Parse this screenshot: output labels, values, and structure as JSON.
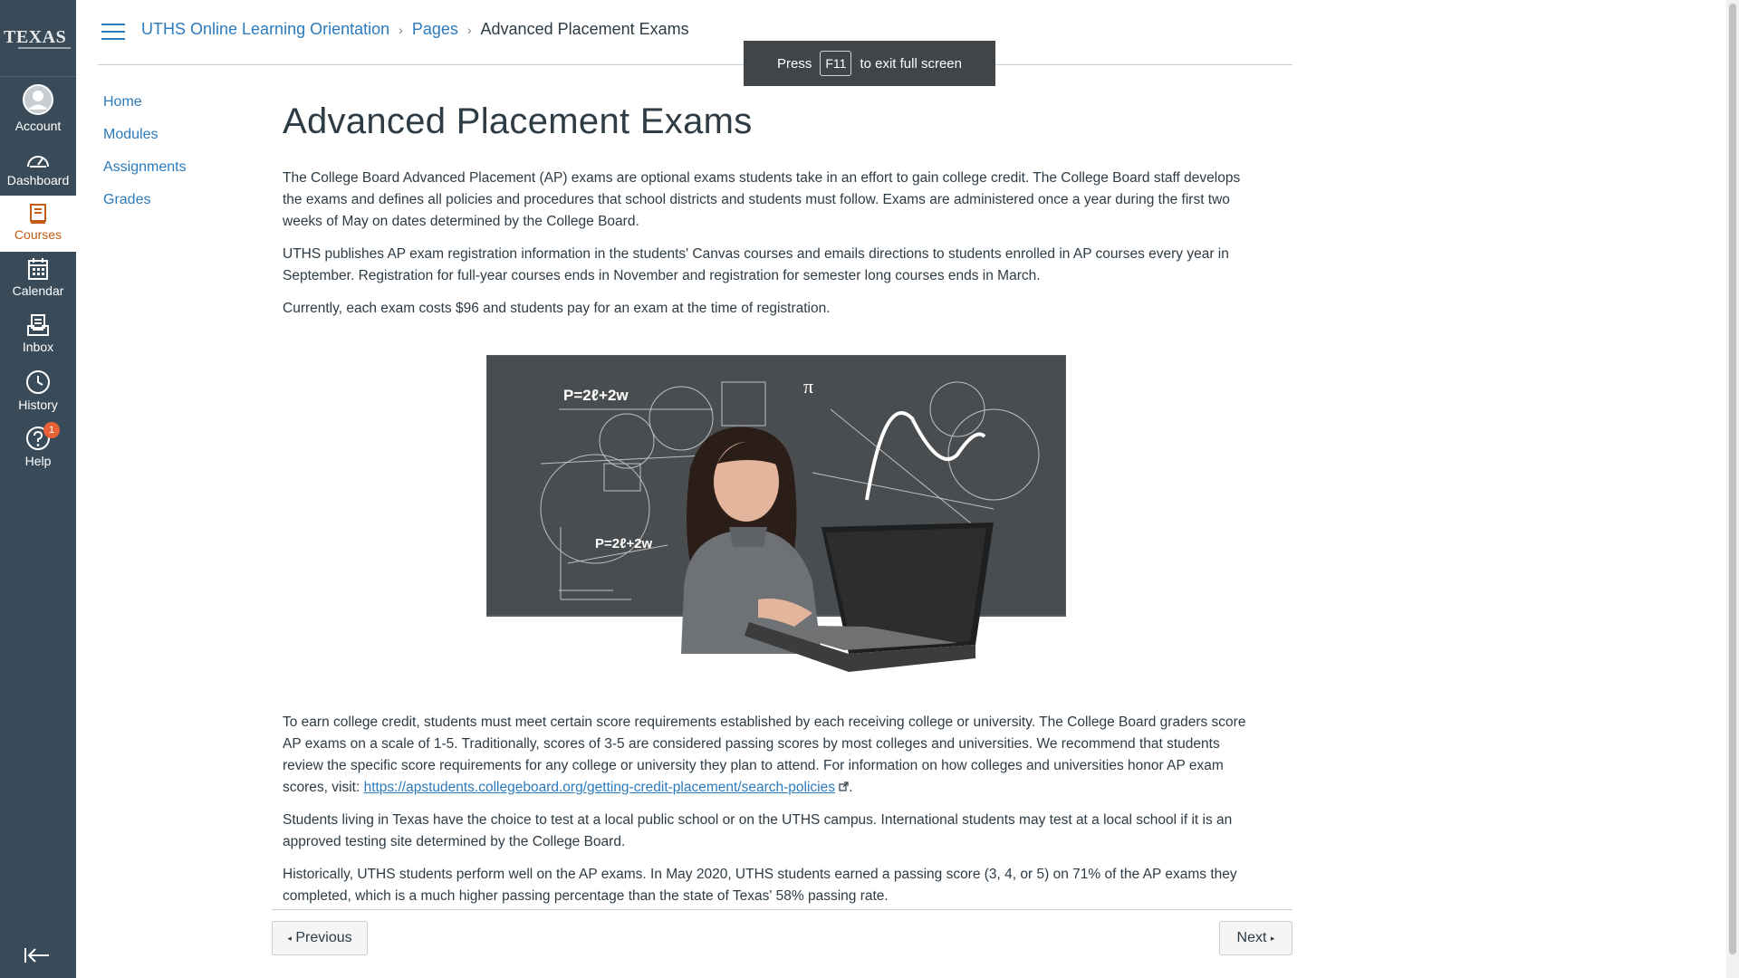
{
  "global_nav": {
    "logo_text": "TEXAS",
    "items": [
      {
        "label": "Account",
        "icon": "account-icon"
      },
      {
        "label": "Dashboard",
        "icon": "dashboard-icon"
      },
      {
        "label": "Courses",
        "icon": "courses-icon",
        "active": true
      },
      {
        "label": "Calendar",
        "icon": "calendar-icon"
      },
      {
        "label": "Inbox",
        "icon": "inbox-icon"
      },
      {
        "label": "History",
        "icon": "history-icon"
      },
      {
        "label": "Help",
        "icon": "help-icon"
      }
    ],
    "help_badge": "1",
    "collapse_icon": "collapse-nav-icon"
  },
  "breadcrumb": {
    "course": "UTHS Online Learning Orientation",
    "section": "Pages",
    "current": "Advanced Placement Exams"
  },
  "fullscreen_notice": {
    "prefix": "Press",
    "key": "F11",
    "suffix": "to exit full screen"
  },
  "course_nav": [
    "Home",
    "Modules",
    "Assignments",
    "Grades"
  ],
  "page": {
    "title": "Advanced Placement Exams",
    "paragraphs": [
      "The College Board Advanced Placement (AP) exams are optional exams students take in an effort to gain college credit. The College Board staff develops the exams and defines all policies and procedures that school districts and students must follow. Exams are administered once a year during the first two weeks of May on dates determined by the College Board.",
      "UTHS publishes AP exam registration information in the students' Canvas courses and emails directions to students enrolled in AP courses every year in September. Registration for full-year courses ends in November and registration for semester long courses ends in March.",
      "Currently, each exam costs $96 and students pay for an exam at the time of registration."
    ],
    "paragraph4_text": "To earn college credit, students must meet certain score requirements established by each receiving college or university. The College Board graders score AP exams on a scale of 1-5. Traditionally, scores of 3-5 are considered passing scores by most colleges and universities. We recommend that students review the specific score requirements for any college or university they plan to attend. For information on how colleges and universities honor AP exam scores, visit: ",
    "paragraph4_link": "https://apstudents.collegeboard.org/getting-credit-placement/search-policies",
    "paragraph4_end": ".",
    "paragraph5": "Students living in Texas have the choice to test at a local public school or on the UTHS campus. International students may test at a local school if it is an approved testing site determined by the College Board.",
    "paragraph6": "Historically, UTHS students perform well on the AP exams. In May 2020, UTHS students earned a passing score (3, 4, or 5) on 71% of the AP exams they completed, which is a much higher passing percentage than the state of Texas' 58% passing rate.",
    "image_formula_1": "P=2ℓ+2w",
    "image_formula_2": "P=2ℓ+2w",
    "image_pi": "π"
  },
  "footer": {
    "previous": "Previous",
    "next": "Next"
  },
  "colors": {
    "nav_bg": "#394b58",
    "link": "#2b7abc",
    "active_course": "#c35c15",
    "badge": "#e66135"
  }
}
